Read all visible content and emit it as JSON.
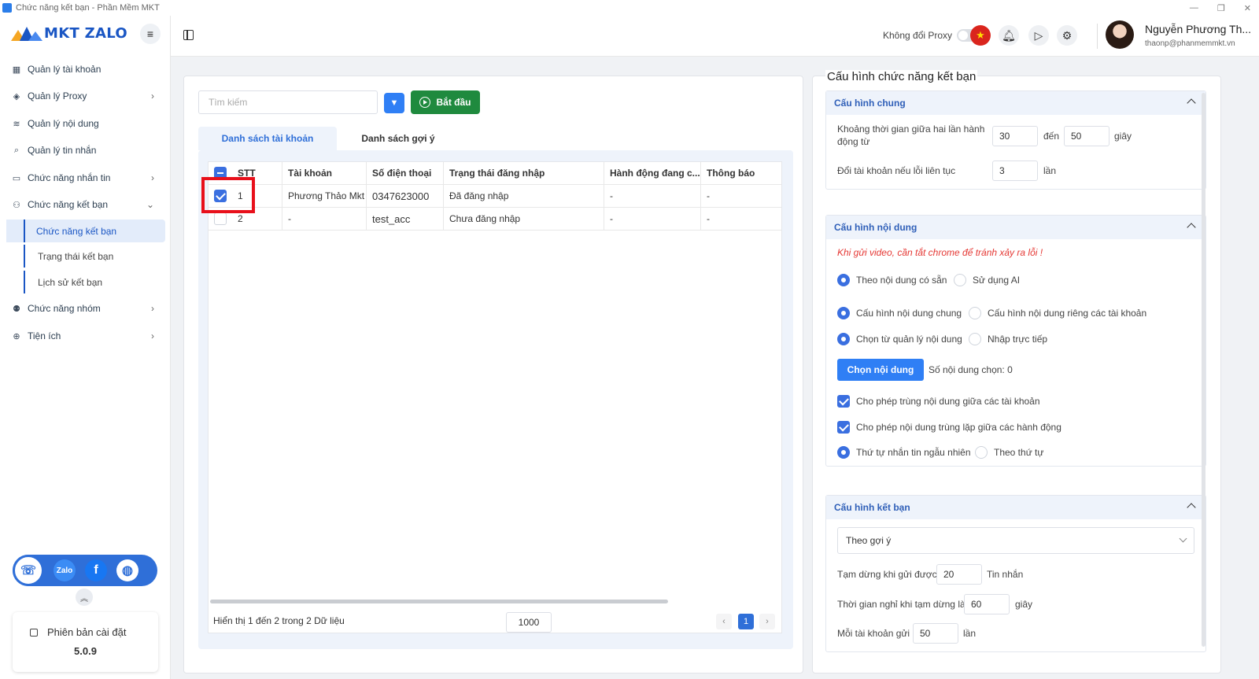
{
  "window": {
    "title": "Chức năng kết bạn - Phần Mềm MKT"
  },
  "brand": {
    "name": "MKT ZALO",
    "color": "#1a56c4"
  },
  "sidebar": {
    "items": [
      {
        "label": "Quản lý tài khoản",
        "icon": "grid-icon"
      },
      {
        "label": "Quản lý Proxy",
        "icon": "layers-icon"
      },
      {
        "label": "Quản lý nội dung",
        "icon": "content-icon"
      },
      {
        "label": "Quản lý tin nhắn",
        "icon": "search-message-icon"
      },
      {
        "label": "Chức năng nhắn tin",
        "icon": "chat-icon"
      },
      {
        "label": "Chức năng kết bạn",
        "icon": "add-user-icon"
      },
      {
        "label": "Chức năng nhóm",
        "icon": "group-icon"
      },
      {
        "label": "Tiện ích",
        "icon": "utility-icon"
      }
    ],
    "sub_items": [
      "Chức năng kết bạn",
      "Trạng thái kết bạn",
      "Lịch sử kết bạn"
    ],
    "social": {
      "zalo": "Zalo",
      "facebook": "f"
    },
    "version_label": "Phiên bản cài đặt",
    "version": "5.0.9"
  },
  "header": {
    "proxy_label": "Không đổi Proxy",
    "user_name": "Nguyễn Phương Th...",
    "user_email": "thaonp@phanmemmkt.vn"
  },
  "left": {
    "search_placeholder": "Tìm kiếm",
    "start_label": "Bắt đầu",
    "tabs": [
      "Danh sách tài khoản",
      "Danh sách gợi ý"
    ],
    "columns": [
      "STT",
      "Tài khoản",
      "Số điện thoại",
      "Trạng thái đăng nhập",
      "Hành động đang c...",
      "Thông báo"
    ],
    "rows": [
      {
        "stt": "1",
        "account": "Phương Thảo Mkt",
        "phone": "0347623000",
        "status": "Đã đăng nhập",
        "action": "-",
        "notice": "-",
        "checked": true
      },
      {
        "stt": "2",
        "account": "-",
        "phone": "test_acc",
        "status": "Chưa đăng nhập",
        "action": "-",
        "notice": "-",
        "checked": false
      }
    ],
    "footer_text": "Hiển thị 1 đến 2 trong 2 Dữ liệu",
    "page_size": "1000",
    "current_page": "1"
  },
  "right": {
    "title": "Cấu hình chức năng kết bạn",
    "general": {
      "title": "Cấu hình chung",
      "interval_label": "Khoảng thời gian giữa hai lần hành động từ",
      "interval_from": "30",
      "interval_to_label": "đến",
      "interval_to": "50",
      "interval_unit": "giây",
      "switch_label": "Đổi tài khoản nếu lỗi liên tục",
      "switch_value": "3",
      "switch_unit": "lần"
    },
    "content": {
      "title": "Cấu hình nội dung",
      "warning": "Khi gửi video, cần tắt chrome để tránh xảy ra lỗi !",
      "radio1": [
        "Theo nội dung có sẵn",
        "Sử dụng AI"
      ],
      "radio2": [
        "Cấu hình nội dung chung",
        "Cấu hình nội dung riêng các tài khoản"
      ],
      "radio3": [
        "Chọn từ quản lý nội dung",
        "Nhập trực tiếp"
      ],
      "choose_label": "Chọn nội dung",
      "chosen_count": "Số nội dung chọn: 0",
      "check1": "Cho phép trùng nội dung giữa các tài khoản",
      "check2": "Cho phép nội dung trùng lặp giữa các hành động",
      "radio4": [
        "Thứ tự nhắn tin ngẫu nhiên",
        "Theo thứ tự"
      ]
    },
    "friend": {
      "title": "Cấu hình kết bạn",
      "select_value": "Theo gợi ý",
      "pause_label": "Tạm dừng khi gửi được",
      "pause_value": "20",
      "pause_unit": "Tin nhắn",
      "rest_label": "Thời gian nghỉ khi tạm dừng là",
      "rest_value": "60",
      "rest_unit": "giây",
      "per_account_label": "Mỗi tài khoản gửi",
      "per_account_value": "50",
      "per_account_unit": "lần"
    }
  }
}
